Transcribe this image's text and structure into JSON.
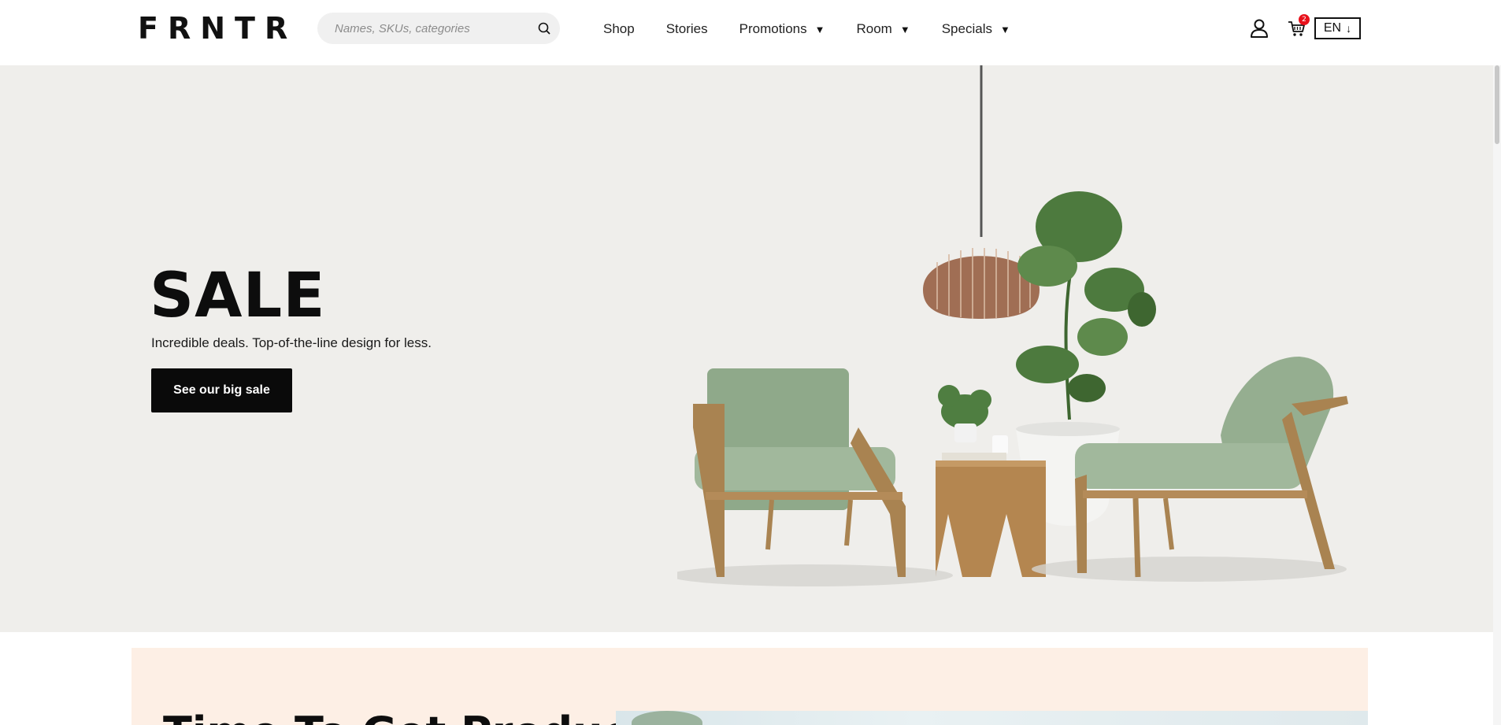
{
  "header": {
    "logo": "FRNTR",
    "search": {
      "placeholder": "Names, SKUs, categories",
      "value": ""
    },
    "nav": [
      {
        "label": "Shop",
        "has_dropdown": false
      },
      {
        "label": "Stories",
        "has_dropdown": false
      },
      {
        "label": "Promotions",
        "has_dropdown": true
      },
      {
        "label": "Room",
        "has_dropdown": true
      },
      {
        "label": "Specials",
        "has_dropdown": true
      }
    ],
    "icons": {
      "search": "search-icon",
      "account": "user-icon",
      "cart": "cart-icon"
    },
    "cart_count": "2",
    "language": "EN"
  },
  "hero": {
    "title": "SALE",
    "subtitle": "Incredible deals. Top-of-the-line design for less.",
    "cta_label": "See our big sale"
  },
  "promo": {
    "title": "Time To Get Productive"
  },
  "colors": {
    "hero_bg": "#efeeeb",
    "promo_bg": "#fdefe5",
    "cta_bg": "#0a0a0a",
    "badge": "#e8111b",
    "chair_green": "#93ad8f",
    "wood": "#b88a55"
  }
}
